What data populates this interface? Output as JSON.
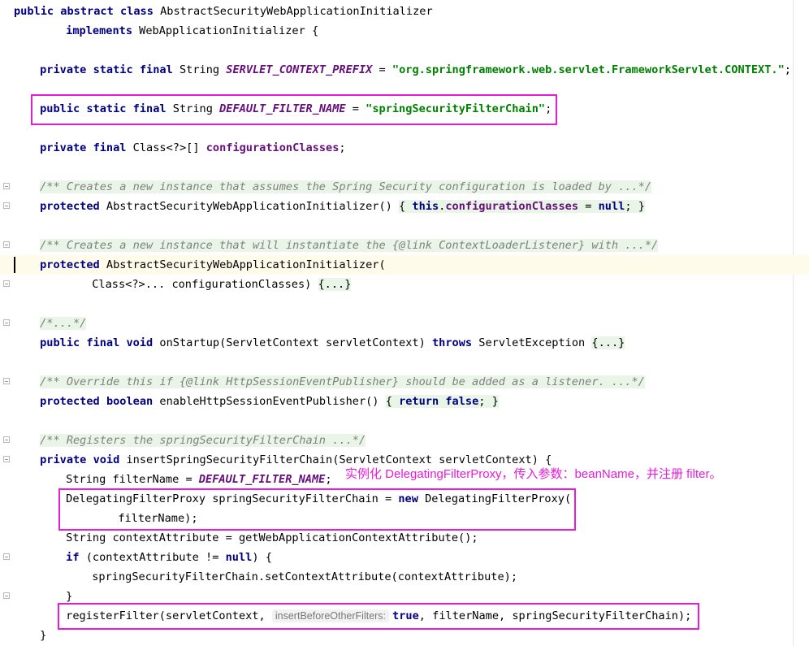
{
  "editor": {
    "current_line": 13,
    "colors": {
      "keyword": "#000080",
      "string": "#008000",
      "constant": "#660e7a",
      "comment": "#808080",
      "folded_background": "#e9f5e6",
      "highlight_box": "#e61cd8",
      "current_line_background": "#fefbea"
    },
    "lines": [
      {
        "n": 0,
        "indent": 0,
        "tokens": [
          {
            "t": "public",
            "c": "kw"
          },
          {
            "t": " "
          },
          {
            "t": "abstract",
            "c": "kw"
          },
          {
            "t": " "
          },
          {
            "t": "class",
            "c": "kw"
          },
          {
            "t": " AbstractSecurityWebApplicationInitializer"
          }
        ]
      },
      {
        "n": 1,
        "indent": 8,
        "tokens": [
          {
            "t": "implements",
            "c": "kw"
          },
          {
            "t": " WebApplicationInitializer {"
          }
        ]
      },
      {
        "n": 3,
        "indent": 4,
        "tokens": [
          {
            "t": "private",
            "c": "kw"
          },
          {
            "t": " "
          },
          {
            "t": "static",
            "c": "kw"
          },
          {
            "t": " "
          },
          {
            "t": "final",
            "c": "kw"
          },
          {
            "t": " String "
          },
          {
            "t": "SERVLET_CONTEXT_PREFIX",
            "c": "cst"
          },
          {
            "t": " = "
          },
          {
            "t": "\"org.springframework.web.servlet.FrameworkServlet.CONTEXT.\"",
            "c": "str"
          },
          {
            "t": ";"
          }
        ]
      },
      {
        "n": 5,
        "indent": 4,
        "tokens": [
          {
            "t": "public",
            "c": "kw"
          },
          {
            "t": " "
          },
          {
            "t": "static",
            "c": "kw"
          },
          {
            "t": " "
          },
          {
            "t": "final",
            "c": "kw"
          },
          {
            "t": " String "
          },
          {
            "t": "DEFAULT_FILTER_NAME",
            "c": "cst"
          },
          {
            "t": " = "
          },
          {
            "t": "\"springSecurityFilterChain\"",
            "c": "str"
          },
          {
            "t": ";"
          }
        ]
      },
      {
        "n": 7,
        "indent": 4,
        "tokens": [
          {
            "t": "private",
            "c": "kw"
          },
          {
            "t": " "
          },
          {
            "t": "final",
            "c": "kw"
          },
          {
            "t": " Class<?>[] "
          },
          {
            "t": "configurationClasses",
            "c": "fld"
          },
          {
            "t": ";"
          }
        ]
      },
      {
        "n": 9,
        "indent": 4,
        "fold": true,
        "tokens": [
          {
            "t": "/** Creates a new instance that assumes the Spring Security configuration is loaded by ...*/",
            "c": "cmt bg-g"
          }
        ]
      },
      {
        "n": 10,
        "indent": 4,
        "fold": true,
        "tokens": [
          {
            "t": "protected",
            "c": "kw"
          },
          {
            "t": " AbstractSecurityWebApplicationInitializer() "
          },
          {
            "t": "{ ",
            "c": "bg-g"
          },
          {
            "t": "this",
            "c": "kw bg-g"
          },
          {
            "t": ".",
            "c": "bg-g"
          },
          {
            "t": "configurationClasses",
            "c": "fld bg-g"
          },
          {
            "t": " = ",
            "c": "bg-g"
          },
          {
            "t": "null",
            "c": "kw bg-g"
          },
          {
            "t": "; }",
            "c": "bg-g"
          }
        ]
      },
      {
        "n": 12,
        "indent": 4,
        "fold": true,
        "tokens": [
          {
            "t": "/** Creates a new instance that will instantiate the {@link ContextLoaderListener} with ...*/",
            "c": "cmt bg-g"
          }
        ]
      },
      {
        "n": 13,
        "indent": 4,
        "caret": true,
        "tokens": [
          {
            "t": "protected",
            "c": "kw"
          },
          {
            "t": " AbstractSecurityWebApplicationInitializer("
          }
        ]
      },
      {
        "n": 14,
        "indent": 12,
        "fold": true,
        "tokens": [
          {
            "t": "Class<?>... configurationClasses) "
          },
          {
            "t": "{...}",
            "c": "bg-g"
          }
        ]
      },
      {
        "n": 16,
        "indent": 4,
        "fold": true,
        "tokens": [
          {
            "t": "/*...*/",
            "c": "cmt bg-g"
          }
        ]
      },
      {
        "n": 17,
        "indent": 4,
        "tokens": [
          {
            "t": "public",
            "c": "kw"
          },
          {
            "t": " "
          },
          {
            "t": "final",
            "c": "kw"
          },
          {
            "t": " "
          },
          {
            "t": "void",
            "c": "kw"
          },
          {
            "t": " onStartup(ServletContext servletContext) "
          },
          {
            "t": "throws",
            "c": "kw"
          },
          {
            "t": " ServletException "
          },
          {
            "t": "{...}",
            "c": "bg-g"
          }
        ]
      },
      {
        "n": 19,
        "indent": 4,
        "fold": true,
        "tokens": [
          {
            "t": "/** Override this if {@link HttpSessionEventPublisher} should be added as a listener. ...*/",
            "c": "cmt bg-g"
          }
        ]
      },
      {
        "n": 20,
        "indent": 4,
        "tokens": [
          {
            "t": "protected",
            "c": "kw"
          },
          {
            "t": " "
          },
          {
            "t": "boolean",
            "c": "kw"
          },
          {
            "t": " enableHttpSessionEventPublisher() "
          },
          {
            "t": "{ ",
            "c": "bg-g"
          },
          {
            "t": "return",
            "c": "kw bg-g"
          },
          {
            "t": " ",
            "c": "bg-g"
          },
          {
            "t": "false",
            "c": "kw bg-g"
          },
          {
            "t": "; }",
            "c": "bg-g"
          }
        ]
      },
      {
        "n": 22,
        "indent": 4,
        "fold": true,
        "tokens": [
          {
            "t": "/** Registers the springSecurityFilterChain ...*/",
            "c": "cmt bg-g"
          }
        ]
      },
      {
        "n": 23,
        "indent": 4,
        "fold": true,
        "tokens": [
          {
            "t": "private",
            "c": "kw"
          },
          {
            "t": " "
          },
          {
            "t": "void",
            "c": "kw"
          },
          {
            "t": " insertSpringSecurityFilterChain(ServletContext servletContext) {"
          }
        ]
      },
      {
        "n": 24,
        "indent": 8,
        "tokens": [
          {
            "t": "String filterName = "
          },
          {
            "t": "DEFAULT_FILTER_NAME",
            "c": "cst"
          },
          {
            "t": ";"
          }
        ]
      },
      {
        "n": 25,
        "indent": 8,
        "tokens": [
          {
            "t": "DelegatingFilterProxy springSecurityFilterChain = "
          },
          {
            "t": "new",
            "c": "kw"
          },
          {
            "t": " DelegatingFilterProxy("
          }
        ]
      },
      {
        "n": 26,
        "indent": 16,
        "tokens": [
          {
            "t": "filterName);"
          }
        ]
      },
      {
        "n": 27,
        "indent": 8,
        "tokens": [
          {
            "t": "String contextAttribute = getWebApplicationContextAttribute();"
          }
        ]
      },
      {
        "n": 28,
        "indent": 8,
        "fold": true,
        "tokens": [
          {
            "t": "if",
            "c": "kw"
          },
          {
            "t": " (contextAttribute != "
          },
          {
            "t": "null",
            "c": "kw"
          },
          {
            "t": ") {"
          }
        ]
      },
      {
        "n": 29,
        "indent": 12,
        "tokens": [
          {
            "t": "springSecurityFilterChain.setContextAttribute(contextAttribute);"
          }
        ]
      },
      {
        "n": 30,
        "indent": 8,
        "fold": true,
        "tokens": [
          {
            "t": "}"
          }
        ]
      },
      {
        "n": 31,
        "indent": 8,
        "tokens": [
          {
            "t": "registerFilter(servletContext, "
          },
          {
            "t": "insertBeforeOtherFilters:",
            "c": "hint"
          },
          {
            "t": "true",
            "c": "kw"
          },
          {
            "t": ", filterName, springSecurityFilterChain);"
          }
        ]
      },
      {
        "n": 32,
        "indent": 4,
        "tokens": [
          {
            "t": "}"
          }
        ]
      }
    ]
  },
  "annotation": {
    "text": "实例化 DelegatingFilterProxy，传入参数：beanName，并注册 filter。"
  }
}
